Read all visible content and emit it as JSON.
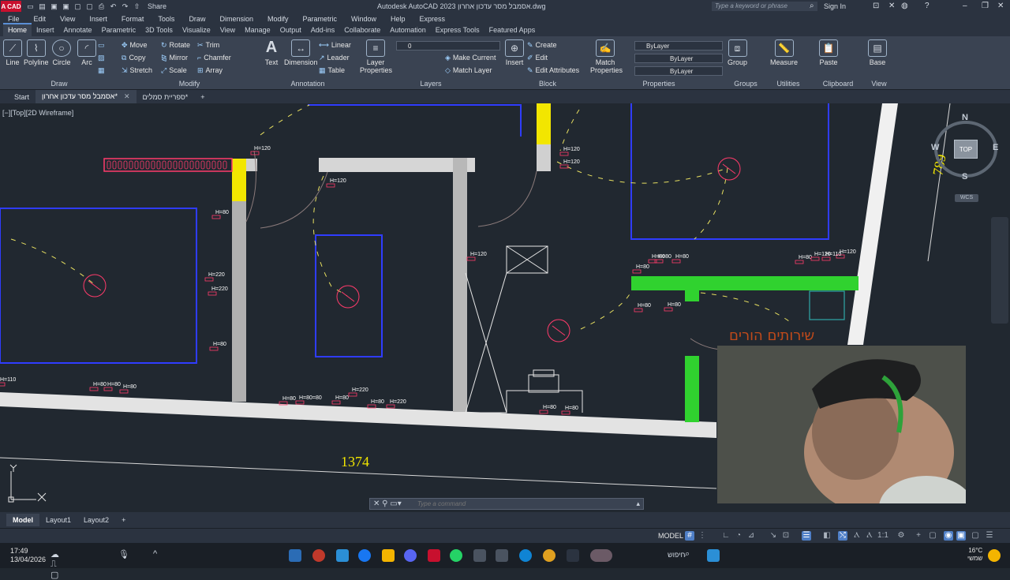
{
  "titlebar": {
    "app_logo": "A CAD",
    "share": "Share",
    "window_title": "Autodesk AutoCAD 2023   אסמבל מסר עדכון אחרון.dwg",
    "search_placeholder": "Type a keyword or phrase",
    "signin": "Sign In"
  },
  "menu": [
    "File",
    "Edit",
    "View",
    "Insert",
    "Format",
    "Tools",
    "Draw",
    "Dimension",
    "Modify",
    "Parametric",
    "Window",
    "Help",
    "Express"
  ],
  "ribbon_tabs": [
    "Home",
    "Insert",
    "Annotate",
    "Parametric",
    "3D Tools",
    "Visualize",
    "View",
    "Manage",
    "Output",
    "Add-ins",
    "Collaborate",
    "Automation",
    "Express Tools",
    "Featured Apps"
  ],
  "ribbon": {
    "draw": {
      "label": "Draw",
      "line": "Line",
      "polyline": "Polyline",
      "circle": "Circle",
      "arc": "Arc"
    },
    "modify": {
      "label": "Modify",
      "move": "Move",
      "rotate": "Rotate",
      "trim": "Trim",
      "copy": "Copy",
      "mirror": "Mirror",
      "chamfer": "Chamfer",
      "stretch": "Stretch",
      "scale": "Scale",
      "array": "Array"
    },
    "annotation": {
      "label": "Annotation",
      "text": "Text",
      "dimension": "Dimension",
      "linear": "Linear",
      "leader": "Leader",
      "table": "Table"
    },
    "layers": {
      "label": "Layers",
      "layer_properties": "Layer Properties",
      "layer_value": "0",
      "make_current": "Make Current",
      "match_layer": "Match Layer"
    },
    "block": {
      "label": "Block",
      "insert": "Insert",
      "create": "Create",
      "edit": "Edit",
      "edit_attributes": "Edit Attributes"
    },
    "properties": {
      "label": "Properties",
      "match_properties": "Match Properties",
      "color": "ByLayer",
      "linetype": "ByLayer",
      "lineweight": "ByLayer"
    },
    "groups": {
      "label": "Groups",
      "group": "Group"
    },
    "utilities": {
      "label": "Utilities",
      "measure": "Measure"
    },
    "clipboard": {
      "label": "Clipboard",
      "paste": "Paste"
    },
    "view": {
      "label": "View",
      "base": "Base"
    }
  },
  "doc_tabs": {
    "start": "Start",
    "tab1": "אסמבל מסר עדכון אחרון*",
    "tab2": "ספריית סמלים*"
  },
  "viewport_label": "[−][Top][2D Wireframe]",
  "drawing": {
    "dim_bottom": "1374",
    "dim_right": "789",
    "room_text": "שירותים הורים",
    "heights": [
      "H=120",
      "H=120",
      "H=120",
      "H=120",
      "H=120",
      "H=80",
      "H=220",
      "H=220",
      "H=80",
      "H=80",
      "H=80",
      "H=80",
      "H=80",
      "H=120",
      "H=120",
      "H=80",
      "H=80",
      "H=80",
      "H=80",
      "H=80",
      "H=80",
      "H=80=80",
      "H=80",
      "H=80",
      "H=220",
      "H=220",
      "H=80",
      "H=80",
      "H=110",
      "H=110",
      "H=80"
    ]
  },
  "viewcube": {
    "n": "N",
    "s": "S",
    "e": "E",
    "w": "W",
    "top": "TOP",
    "wcs": "WCS"
  },
  "command": {
    "placeholder": "Type a command"
  },
  "layout_tabs": [
    "Model",
    "Layout1",
    "Layout2"
  ],
  "status": {
    "model": "MODEL",
    "scale": "1:1"
  },
  "taskbar": {
    "time": "17:49",
    "date": "13/04/2026",
    "search": "חיפוש",
    "temp": "16°C",
    "weather": "שמשי"
  }
}
